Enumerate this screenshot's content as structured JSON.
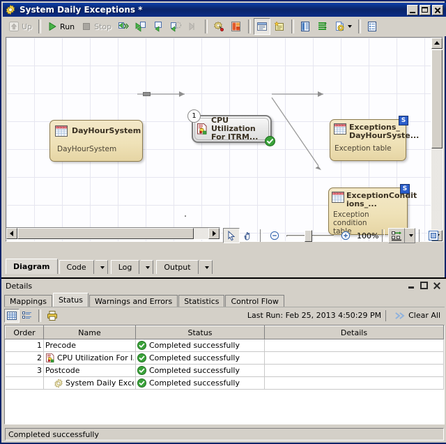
{
  "window": {
    "title": "System Daily Exceptions *",
    "icon": "gear-icon",
    "buttons": {
      "minimize": "Minimize",
      "maximize": "Maximize",
      "close": "Close"
    }
  },
  "toolbar": {
    "up_label": "Up",
    "run_label": "Run",
    "stop_label": "Stop",
    "items": [
      {
        "name": "up-button",
        "label": "Up",
        "icon": "up-arrow-icon",
        "enabled": false
      },
      {
        "name": "run-button",
        "label": "Run",
        "icon": "play-icon",
        "enabled": true
      },
      {
        "name": "stop-button",
        "label": "Stop",
        "icon": "stop-square-icon",
        "enabled": false
      },
      {
        "name": "step-over-button",
        "label": "",
        "icon": "step-over-icon",
        "enabled": true
      },
      {
        "name": "step-into-button",
        "label": "",
        "icon": "step-into-icon",
        "enabled": true
      },
      {
        "name": "run-to-cursor-button",
        "label": "",
        "icon": "run-to-cursor-icon",
        "enabled": true
      },
      {
        "name": "step-out-button",
        "label": "",
        "icon": "step-out-icon",
        "enabled": true
      },
      {
        "name": "continue-button",
        "label": "",
        "icon": "continue-icon",
        "enabled": false
      },
      {
        "name": "settings-button",
        "label": "",
        "icon": "gear-red-dot-icon",
        "enabled": true
      },
      {
        "name": "export-button",
        "label": "",
        "icon": "document-export-icon",
        "enabled": true
      },
      {
        "name": "details-toggle-button",
        "label": "",
        "icon": "details-panel-icon",
        "enabled": true
      },
      {
        "name": "notes-button",
        "label": "",
        "icon": "notes-star-icon",
        "enabled": true
      },
      {
        "name": "columns-button",
        "label": "",
        "icon": "blue-columns-icon",
        "enabled": true
      },
      {
        "name": "list-button",
        "label": "",
        "icon": "green-list-icon",
        "enabled": true
      },
      {
        "name": "report-dropdown-button",
        "label": "",
        "icon": "report-gear-icon",
        "enabled": true
      },
      {
        "name": "properties-button",
        "label": "",
        "icon": "properties-icon",
        "enabled": true
      }
    ]
  },
  "diagram": {
    "nodes": [
      {
        "name": "node-dayhoursystem",
        "kind": "table",
        "title": "DayHourSystem",
        "subtitle": "DayHourSystem",
        "icon": "table-icon",
        "badge": null
      },
      {
        "name": "node-cpu-utilization",
        "kind": "process",
        "title_line1": "CPU Utilization",
        "title_line2": "For ITRM...",
        "icon": "transform-icon",
        "step_number": "1",
        "status_icon": "green-check-icon"
      },
      {
        "name": "node-exceptions-dayhoursystem",
        "kind": "table",
        "title_line1": "Exceptions_",
        "title_line2": "DayHourSyste...",
        "subtitle": "Exception  table",
        "icon": "table-icon",
        "badge": "S"
      },
      {
        "name": "node-exceptionconditions",
        "kind": "table",
        "title_line1": "ExceptionCondit",
        "title_line2": "ions_...",
        "subtitle_line1": "Exception condition",
        "subtitle_line2": "table",
        "icon": "table-icon",
        "badge": "S"
      }
    ]
  },
  "canvas_tools": {
    "select_tool": "select-arrow-tool",
    "pan_tool": "pan-hand-tool",
    "zoom_out": "zoom-out-icon",
    "zoom_in": "zoom-in-icon",
    "zoom_percent": "100%",
    "layout_button": "auto-layout-icon",
    "layout_dropdown": "chevron-down-icon",
    "fit_button": "fit-to-window-icon"
  },
  "editor_tabs": [
    {
      "label": "Diagram",
      "active": true,
      "has_arrow": false
    },
    {
      "label": "Code",
      "active": false,
      "has_arrow": true
    },
    {
      "label": "Log",
      "active": false,
      "has_arrow": true
    },
    {
      "label": "Output",
      "active": false,
      "has_arrow": true
    }
  ],
  "details": {
    "title": "Details",
    "tabs": [
      {
        "label": "Mappings",
        "active": false
      },
      {
        "label": "Status",
        "active": true
      },
      {
        "label": "Warnings and Errors",
        "active": false
      },
      {
        "label": "Statistics",
        "active": false
      },
      {
        "label": "Control Flow",
        "active": false
      }
    ],
    "toolbar": {
      "grid_view": "grid-view-icon",
      "list_view": "list-view-icon",
      "print": "printer-icon",
      "last_run_label": "Last Run: Feb 25, 2013 4:50:29 PM",
      "clear_all_label": "Clear All",
      "clear_all_icon": "clear-all-icon"
    },
    "table": {
      "columns": [
        "Order",
        "Name",
        "Status",
        "Details"
      ],
      "rows": [
        {
          "order": "1",
          "name": "Precode",
          "icon": null,
          "status": "Completed successfully",
          "status_icon": "green-check-icon",
          "details": ""
        },
        {
          "order": "2",
          "name": "CPU Utilization For I...",
          "icon": "transform-icon",
          "status": "Completed successfully",
          "status_icon": "green-check-icon",
          "details": ""
        },
        {
          "order": "3",
          "name": "Postcode",
          "icon": null,
          "status": "Completed successfully",
          "status_icon": "green-check-icon",
          "details": ""
        },
        {
          "order": "",
          "name": "System Daily Except...",
          "icon": "gear-icon",
          "status": "Completed successfully",
          "status_icon": "green-check-icon",
          "details": ""
        }
      ]
    }
  },
  "statusbar": {
    "message": "Completed successfully"
  },
  "colors": {
    "title_bar": "#0a246a",
    "window_face": "#d4d0c8",
    "table_node_fill": "#efe2b8",
    "success_green": "#3aa23a",
    "badge_blue": "#2b5ecb"
  }
}
